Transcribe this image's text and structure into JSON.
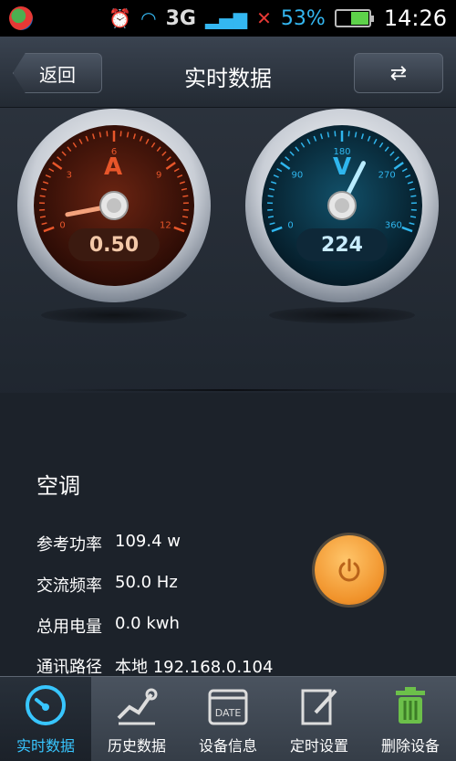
{
  "status_bar": {
    "network": "3G",
    "battery_percent": "53%",
    "battery_level": 0.53,
    "time": "14:26",
    "icons": [
      "app-icon",
      "alarm-icon",
      "wifi-icon",
      "signal-icon",
      "no-signal-icon",
      "battery-icon"
    ]
  },
  "header": {
    "back_label": "返回",
    "title": "实时数据",
    "sync_icon": "sync-icon"
  },
  "gauges": {
    "current": {
      "letter": "A",
      "value": "0.50",
      "ticks": [
        "0",
        "3",
        "6",
        "9",
        "12"
      ],
      "needle_value": 0.5,
      "max": 12,
      "accent": "#e8562a"
    },
    "voltage": {
      "letter": "V",
      "value": "224",
      "ticks": [
        "0",
        "90",
        "180",
        "270",
        "360"
      ],
      "needle_value": 224,
      "max": 360,
      "accent": "#2fb6ee"
    }
  },
  "device": {
    "name": "空调",
    "rows": [
      {
        "label": "参考功率",
        "value": "109.4  w"
      },
      {
        "label": "交流频率",
        "value": "50.0  Hz"
      },
      {
        "label": "总用电量",
        "value": "0.0  kwh"
      },
      {
        "label": "通讯路径",
        "value": "本地 192.168.0.104"
      }
    ],
    "power_icon": "power-icon",
    "power_color": "#f0922a"
  },
  "nav": [
    {
      "label": "实时数据",
      "icon": "gauge-icon",
      "active": true
    },
    {
      "label": "历史数据",
      "icon": "chart-line-icon",
      "active": false
    },
    {
      "label": "设备信息",
      "icon": "date-icon",
      "active": false
    },
    {
      "label": "定时设置",
      "icon": "edit-icon",
      "active": false
    },
    {
      "label": "删除设备",
      "icon": "trash-icon",
      "active": false
    }
  ],
  "nav_date_text": "DATE"
}
